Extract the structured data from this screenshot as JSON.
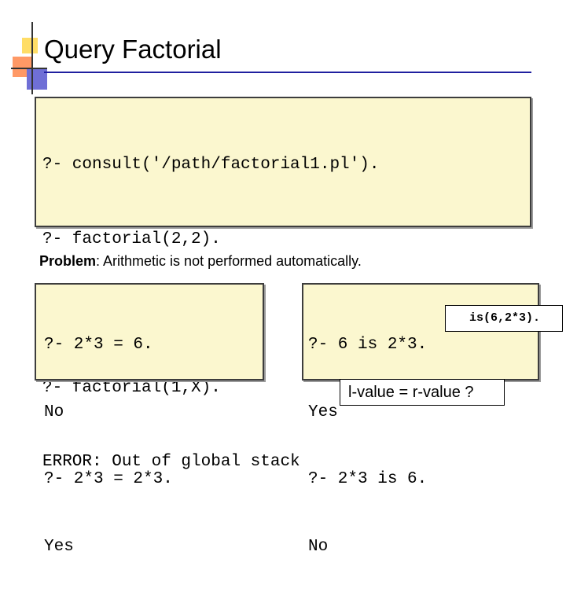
{
  "title": "Query Factorial",
  "main_panel": {
    "lines": [
      "?- consult('/path/factorial1.pl').",
      "?- factorial(2,2).",
      "No",
      "?- factorial(1,X).",
      "ERROR: Out of global stack"
    ]
  },
  "problem": {
    "label": "Problem",
    "text": ":  Arithmetic is not performed automatically."
  },
  "left_panel": {
    "lines": [
      "?- 2*3 = 6.",
      "No",
      "?- 2*3 = 2*3.",
      "Yes"
    ]
  },
  "right_panel": {
    "lines": [
      "?- 6 is 2*3.",
      "Yes",
      "?- 2*3 is 6.",
      "No"
    ]
  },
  "is_callout": "is(6,2*3).",
  "lvalue_callout": "l-value = r-value ?",
  "colors": {
    "panel_background": "#fbf7cf",
    "title_rule": "#1f1f9f"
  }
}
